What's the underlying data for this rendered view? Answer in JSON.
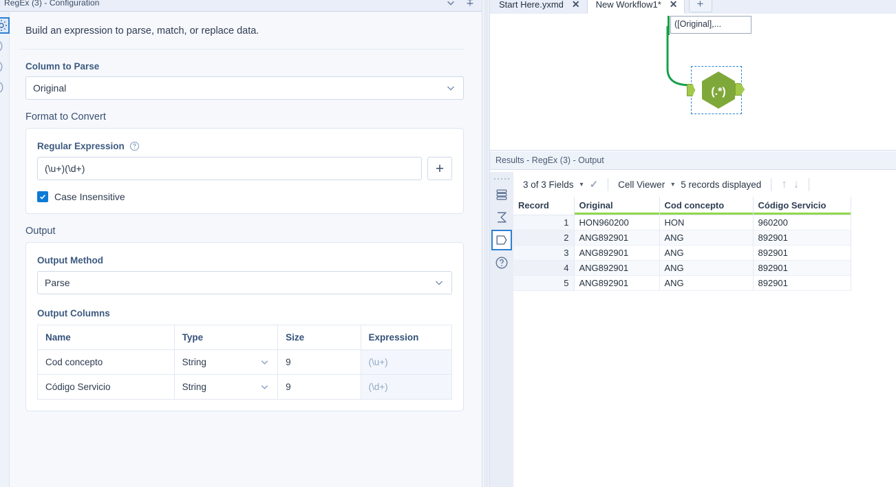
{
  "config": {
    "title": "RegEx (3) - Configuration",
    "intro": "Build an expression to parse, match, or replace data.",
    "column_to_parse": {
      "label": "Column to Parse",
      "value": "Original"
    },
    "format_to_convert": {
      "label": "Format to Convert",
      "regex_label": "Regular Expression",
      "regex_value": "(\\u+)(\\d+)",
      "add_button": "+",
      "case_insensitive_label": "Case Insensitive",
      "case_insensitive_checked": true
    },
    "output": {
      "label": "Output",
      "method_label": "Output Method",
      "method_value": "Parse",
      "columns_label": "Output Columns",
      "headers": [
        "Name",
        "Type",
        "Size",
        "Expression"
      ],
      "rows": [
        {
          "name": "Cod concepto",
          "type": "String",
          "size": "9",
          "expression": "(\\u+)"
        },
        {
          "name": "Código Servicio",
          "type": "String",
          "size": "9",
          "expression": "(\\d+)"
        }
      ]
    },
    "titlebar_icons": [
      "chevron-down-icon",
      "pin-icon"
    ],
    "rail_icons": [
      "gear-icon",
      "chevron-icon-1",
      "chevron-icon-2",
      "chevron-icon-3"
    ]
  },
  "workflow": {
    "tabs": [
      {
        "label": "Start Here.yxmd",
        "active": false,
        "close": "✕"
      },
      {
        "label": "New Workflow1*",
        "active": true,
        "close": "✕"
      }
    ],
    "new_tab_label": "+",
    "annotation": "([Original],...",
    "node_glyph": "(.*)",
    "node_selected": true,
    "accent_node": "#7fa83a",
    "accent_connection": "#19a04b"
  },
  "results": {
    "title": "Results - RegEx (3) - Output",
    "toolbar": {
      "fields": "3 of 3 Fields",
      "viewer": "Cell Viewer",
      "records": "5 records displayed",
      "caret": "▾",
      "check": "✓",
      "up_arrow": "↑",
      "down_arrow": "↓"
    },
    "rail_icons": [
      "table-icon",
      "summary-sigma-icon",
      "data-profile-icon",
      "help-icon"
    ],
    "headers": [
      "Record",
      "Original",
      "Cod concepto",
      "Código Servicio"
    ],
    "rows": [
      {
        "record": "1",
        "original": "HON960200",
        "cod": "HON",
        "servicio": "960200"
      },
      {
        "record": "2",
        "original": "ANG892901",
        "cod": "ANG",
        "servicio": "892901"
      },
      {
        "record": "3",
        "original": "ANG892901",
        "cod": "ANG",
        "servicio": "892901"
      },
      {
        "record": "4",
        "original": "ANG892901",
        "cod": "ANG",
        "servicio": "892901"
      },
      {
        "record": "5",
        "original": "ANG892901",
        "cod": "ANG",
        "servicio": "892901"
      }
    ],
    "header_accent": "#8fd94a"
  }
}
